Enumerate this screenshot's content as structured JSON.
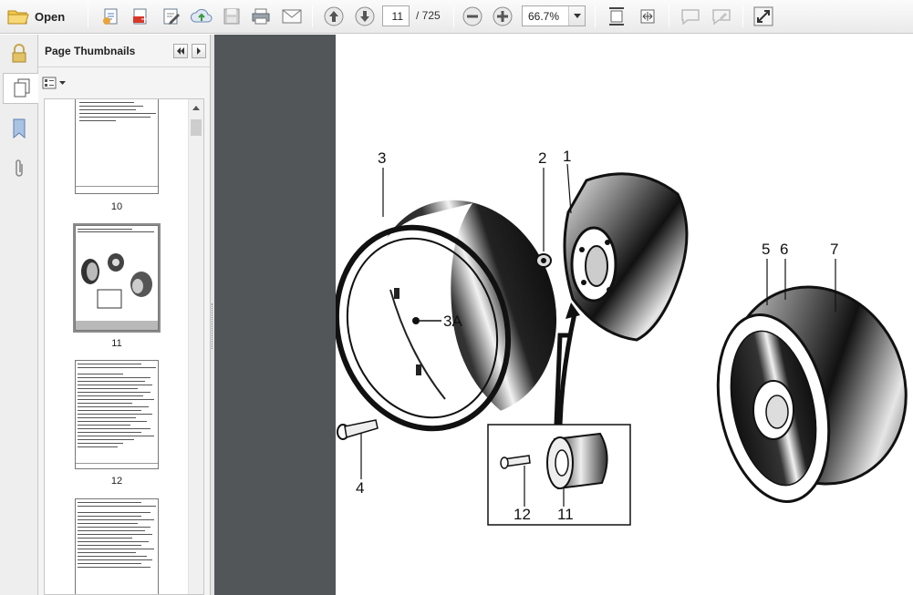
{
  "toolbar": {
    "open_label": "Open",
    "current_page": "11",
    "page_total": "/ 725",
    "zoom": "66.7%"
  },
  "panel": {
    "title": "Page Thumbnails",
    "thumbnails": [
      {
        "label": "10"
      },
      {
        "label": "11"
      },
      {
        "label": "12"
      }
    ]
  },
  "figure": {
    "callouts": [
      "3",
      "2",
      "1",
      "3A",
      "5",
      "6",
      "7",
      "4",
      "12",
      "11"
    ]
  }
}
